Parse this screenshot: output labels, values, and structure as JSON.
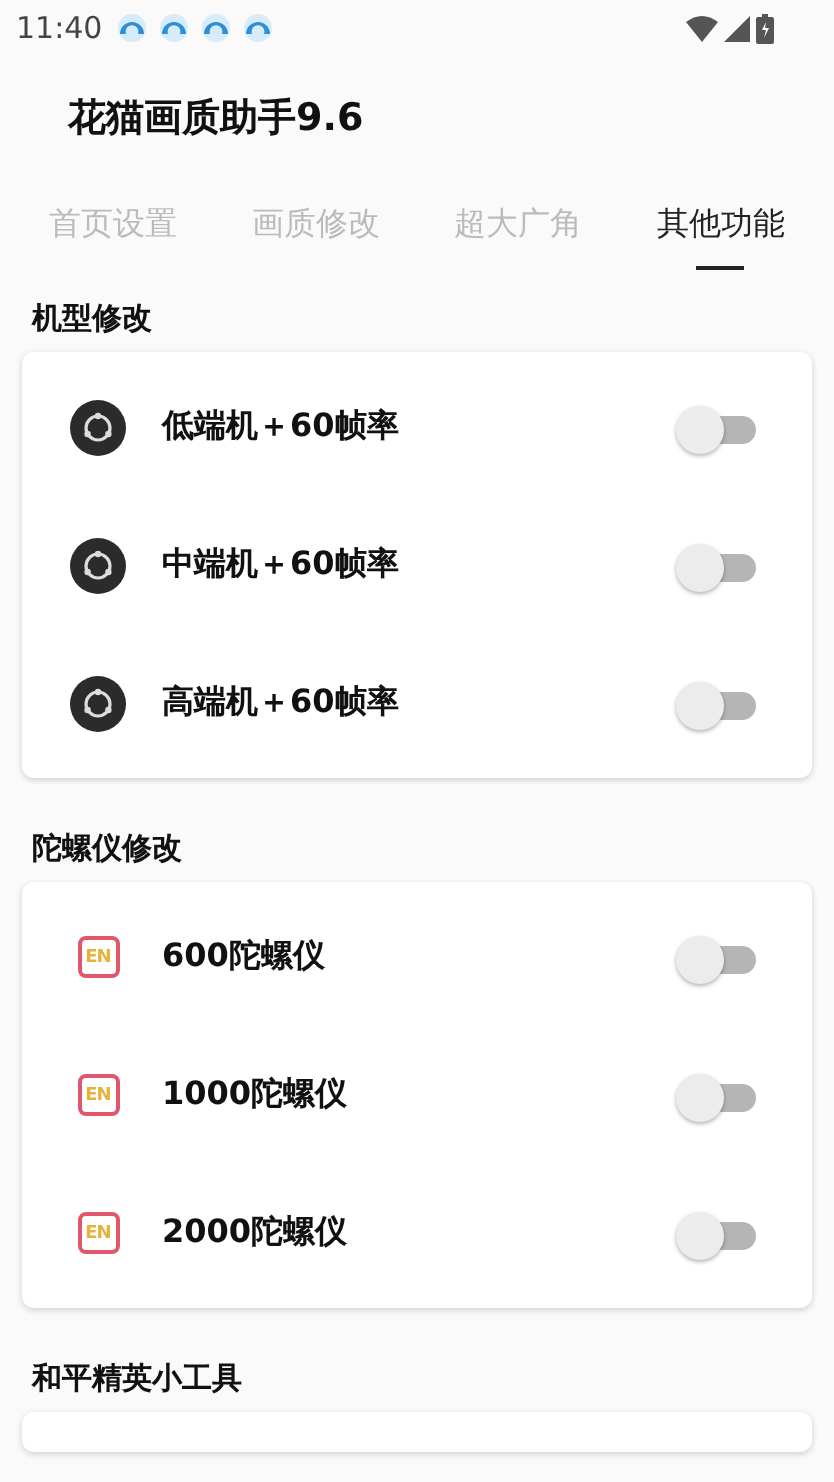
{
  "status_bar": {
    "time": "11:40"
  },
  "app_bar": {
    "title": "花猫画质助手9.6"
  },
  "tabs": [
    {
      "label": "首页设置",
      "selected": false
    },
    {
      "label": "画质修改",
      "selected": false
    },
    {
      "label": "超大广角",
      "selected": false
    },
    {
      "label": "其他功能",
      "selected": true
    }
  ],
  "sections": [
    {
      "title": "机型修改",
      "items": [
        {
          "kind": "disc",
          "label": "低端机＋60帧率",
          "checked": false
        },
        {
          "kind": "disc",
          "label": "中端机＋60帧率",
          "checked": false
        },
        {
          "kind": "disc",
          "label": "高端机＋60帧率",
          "checked": false
        }
      ]
    },
    {
      "title": "陀螺仪修改",
      "items": [
        {
          "kind": "badge",
          "icon_text": "EN",
          "label": "600陀螺仪",
          "checked": false
        },
        {
          "kind": "badge",
          "icon_text": "EN",
          "label": "1000陀螺仪",
          "checked": false
        },
        {
          "kind": "badge",
          "icon_text": "EN",
          "label": "2000陀螺仪",
          "checked": false
        }
      ]
    },
    {
      "title": "和平精英小工具"
    }
  ]
}
